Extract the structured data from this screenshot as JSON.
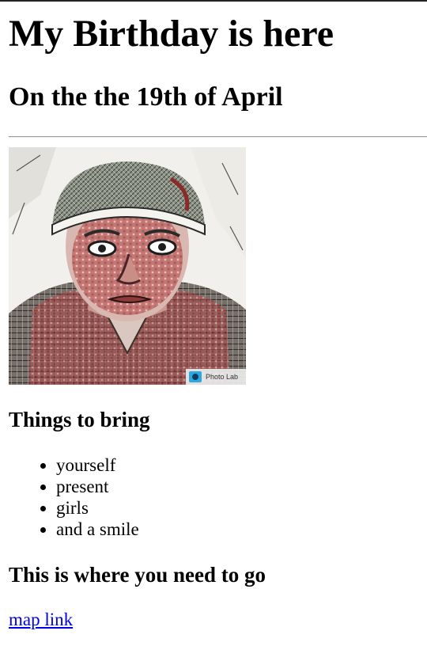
{
  "heading": "My Birthday is here",
  "subheading": "On the the 19th of April",
  "photo": {
    "watermark_text": "Photo Lab"
  },
  "bring": {
    "heading": "Things to bring",
    "items": [
      "yourself",
      "present",
      "girls",
      "and a smile"
    ]
  },
  "directions": {
    "heading": "This is where you need to go",
    "link_text": "map link"
  },
  "colors": {
    "link": "#0000ee",
    "text": "#000000",
    "background": "#ffffff"
  }
}
